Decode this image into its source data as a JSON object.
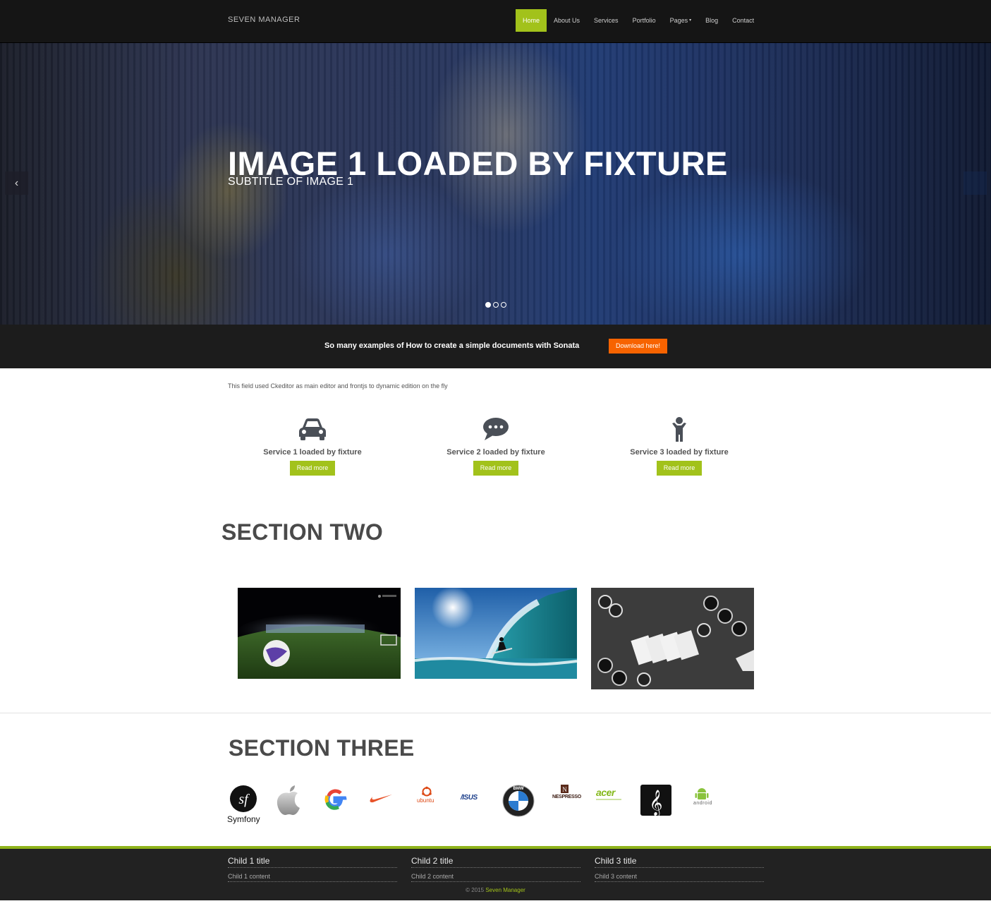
{
  "header": {
    "brand": "SEVEN MANAGER",
    "nav": [
      "Home",
      "About Us",
      "Services",
      "Portfolio",
      "Pages",
      "Blog",
      "Contact"
    ],
    "active": "Home",
    "accent_color": "#a2c21b"
  },
  "hero": {
    "title": "IMAGE 1 LOADED BY FIXTURE",
    "subtitle": "SUBTITLE OF IMAGE 1",
    "prev_icon": "chevron-left-icon",
    "next_icon": "chevron-right-icon",
    "slides": 3,
    "active_slide": 1
  },
  "cta": {
    "text": "So many examples of How to create a simple documents with Sonata",
    "button": "Download here!",
    "button_color": "#f76300"
  },
  "intro": "This field used Ckeditor as main editor and frontjs to dynamic edition on the fly",
  "services": [
    {
      "icon": "car-icon",
      "title": "Service 1 loaded by fixture",
      "button": "Read more"
    },
    {
      "icon": "chat-icon",
      "title": "Service 2 loaded by fixture",
      "button": "Read more"
    },
    {
      "icon": "person-icon",
      "title": "Service 3 loaded by fixture",
      "button": "Read more"
    }
  ],
  "section_two": {
    "title": "SECTION TWO",
    "images": [
      "soccer-ball-stadium-image",
      "surfer-wave-image",
      "poker-cards-chips-image"
    ]
  },
  "section_three": {
    "title": "SECTION THREE",
    "logos": [
      "symfony-logo",
      "apple-logo",
      "google-logo",
      "nike-logo",
      "ubuntu-logo",
      "asus-logo",
      "bmw-logo",
      "nespresso-logo",
      "acer-logo",
      "treble-clef-logo",
      "android-logo"
    ],
    "symfony_label": "Symfony",
    "ubuntu_label": "ubuntu",
    "asus_label": "/ISUS",
    "nespresso_label": "NESPRESSO",
    "acer_label": "acer",
    "android_label": "android",
    "bmw_label": "BMW"
  },
  "footer": {
    "columns": [
      {
        "title": "Child 1 title",
        "content": "Child 1 content"
      },
      {
        "title": "Child 2 title",
        "content": "Child 2 content"
      },
      {
        "title": "Child 3 title",
        "content": "Child 3 content"
      }
    ],
    "copyright_prefix": "© 2015",
    "copyright_name": "Seven Manager"
  }
}
